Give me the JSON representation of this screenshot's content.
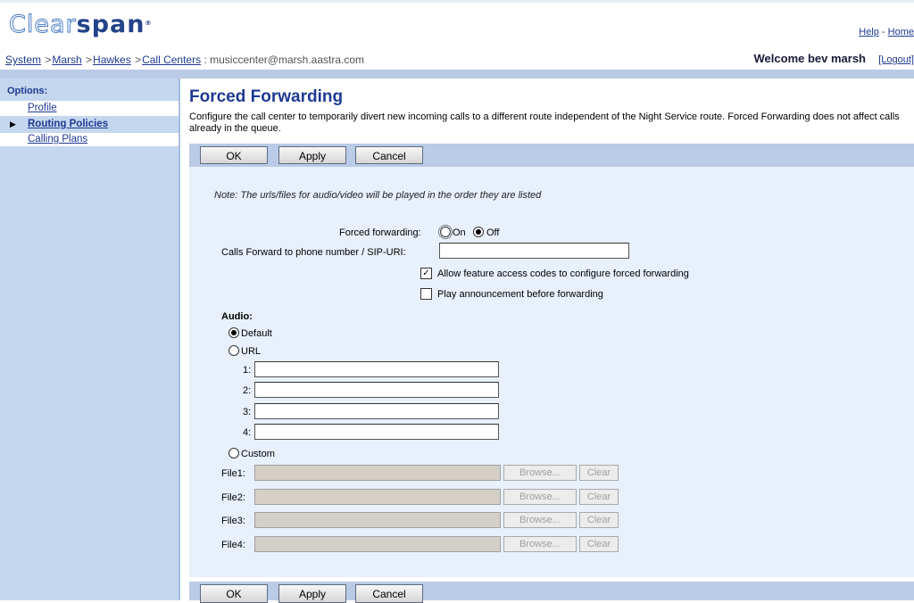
{
  "header": {
    "logo_part1": "Clear",
    "logo_part2": "span",
    "logo_mark": "®",
    "help_link": "Help",
    "separator": " - ",
    "home_link": "Home",
    "breadcrumb": [
      "System",
      "Marsh",
      "Hawkes",
      "Call Centers"
    ],
    "breadcrumb_sep": " >",
    "breadcrumb_tail": " : musiccenter@marsh.aastra.com",
    "welcome": "Welcome bev marsh",
    "logout": "[Logout]"
  },
  "sidebar": {
    "title": "Options:",
    "items": [
      {
        "label": "Profile",
        "active": false
      },
      {
        "label": "Routing Policies",
        "active": true
      },
      {
        "label": "Calling Plans",
        "active": false
      }
    ],
    "active_marker": "▶"
  },
  "main": {
    "title": "Forced Forwarding",
    "description": "Configure the call center to temporarily divert new incoming calls to a different route independent of the Night Service route. Forced Forwarding does not affect calls already in the queue.",
    "buttons": {
      "ok": "OK",
      "apply": "Apply",
      "cancel": "Cancel"
    },
    "note": "Note: The urls/files for audio/video will be played in the order they are listed",
    "forced_forwarding": {
      "label": "Forced forwarding:",
      "on_label": "On",
      "off_label": "Off",
      "selected": "Off"
    },
    "calls_forward": {
      "label": "Calls Forward to phone number / SIP-URI:",
      "value": ""
    },
    "allow_fac": {
      "label": "Allow feature access codes to configure forced forwarding",
      "checked": true
    },
    "play_announcement": {
      "label": "Play announcement before forwarding",
      "checked": false
    },
    "audio": {
      "label": "Audio:",
      "default_label": "Default",
      "url_label": "URL",
      "custom_label": "Custom",
      "selected": "Default",
      "url_rows": [
        {
          "label": "1:",
          "value": ""
        },
        {
          "label": "2:",
          "value": ""
        },
        {
          "label": "3:",
          "value": ""
        },
        {
          "label": "4:",
          "value": ""
        }
      ],
      "file_rows": [
        {
          "label": "File1:",
          "value": ""
        },
        {
          "label": "File2:",
          "value": ""
        },
        {
          "label": "File3:",
          "value": ""
        },
        {
          "label": "File4:",
          "value": ""
        }
      ],
      "browse_label": "Browse...",
      "clear_label": "Clear"
    }
  },
  "colors": {
    "brand_blue": "#1f3a93",
    "band_blue": "#b9cbe7",
    "panel_blue": "#e7f0fb",
    "sidebar_blue": "#c5d6ef"
  }
}
